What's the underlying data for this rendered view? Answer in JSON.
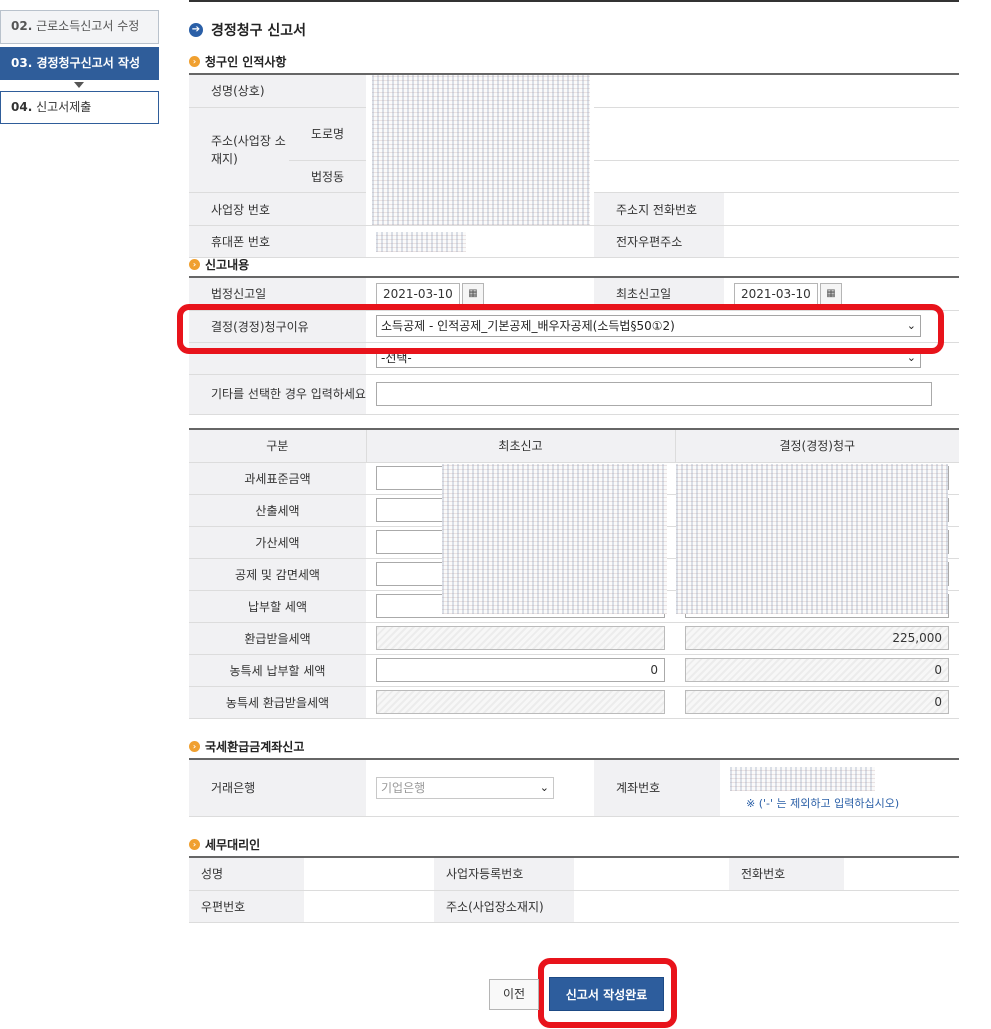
{
  "steps": [
    {
      "num": "02.",
      "label": "근로소득신고서 수정"
    },
    {
      "num": "03.",
      "label": "경정청구신고서 작성"
    },
    {
      "num": "04.",
      "label": "신고서제출"
    }
  ],
  "page_title": "경정청구 신고서",
  "claimant": {
    "section": "청구인 인적사항",
    "name_label": "성명(상호)",
    "address_label": "주소(사업장 소재지)",
    "road_label": "도로명",
    "lot_label": "법정동",
    "biz_no_label": "사업장 번호",
    "phone_label": "주소지 전화번호",
    "mobile_label": "휴대폰 번호",
    "email_label": "전자우편주소"
  },
  "report": {
    "section": "신고내용",
    "legal_date_label": "법정신고일",
    "legal_date": "2021-03-10",
    "first_date_label": "최초신고일",
    "first_date": "2021-03-10",
    "reason_label": "결정(경정)청구이유",
    "reason_value": "소득공제 - 인적공제_기본공제_배우자공제(소득법§50①2)",
    "reason2_value": "-선택-",
    "other_label": "기타를 선택한 경우 입력하세요"
  },
  "amounts": {
    "headers": [
      "구분",
      "최초신고",
      "결정(경정)청구"
    ],
    "rows": [
      {
        "label": "과세표준금액",
        "first": "",
        "claim": ""
      },
      {
        "label": "산출세액",
        "first": "",
        "claim": ""
      },
      {
        "label": "가산세액",
        "first": "",
        "claim": ""
      },
      {
        "label": "공제 및 감면세액",
        "first": "",
        "claim": ""
      },
      {
        "label": "납부할 세액",
        "first": "",
        "claim": ""
      },
      {
        "label": "환급받을세액",
        "first": "",
        "claim": "225,000"
      },
      {
        "label": "농특세 납부할 세액",
        "first": "0",
        "claim": "0"
      },
      {
        "label": "농특세 환급받을세액",
        "first": "",
        "claim": "0"
      }
    ]
  },
  "refund": {
    "section": "국세환급금계좌신고",
    "bank_label": "거래은행",
    "bank_value": "기업은행",
    "account_label": "계좌번호",
    "account_note": "※ ('-' 는 제외하고 입력하십시오)"
  },
  "agent": {
    "section": "세무대리인",
    "name_label": "성명",
    "biz_reg_label": "사업자등록번호",
    "phone_label": "전화번호",
    "zip_label": "우편번호",
    "address_label": "주소(사업장소재지)"
  },
  "buttons": {
    "prev": "이전",
    "complete": "신고서 작성완료"
  },
  "colors": {
    "accent": "#2f5d9a",
    "highlight": "#e8131b",
    "section_icon": "#f0a030"
  }
}
